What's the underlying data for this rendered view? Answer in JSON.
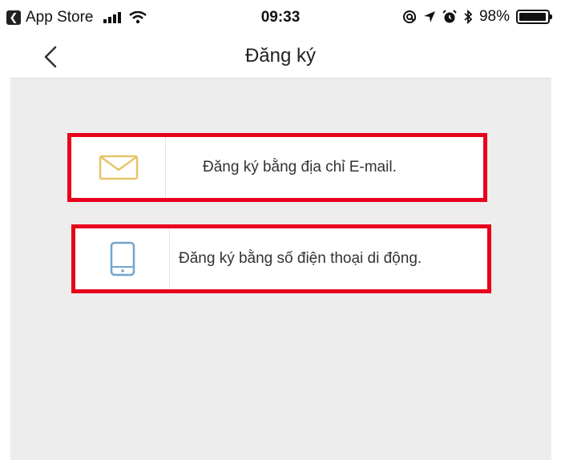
{
  "status_bar": {
    "back_app_label": "App Store",
    "time": "09:33",
    "battery_text": "98%",
    "battery_level": 0.98
  },
  "nav": {
    "title": "Đăng ký",
    "back_icon": "chevron-left-icon"
  },
  "options": {
    "email": {
      "label": "Đăng ký bằng địa chỉ E-mail.",
      "icon": "envelope-icon",
      "icon_color": "#e5c46a"
    },
    "phone": {
      "label": "Đăng ký bằng số điện thoại di động.",
      "icon": "mobile-phone-icon",
      "icon_color": "#6fa5cf"
    }
  },
  "colors": {
    "highlight_border": "#e8001c",
    "content_background": "#ededed"
  }
}
